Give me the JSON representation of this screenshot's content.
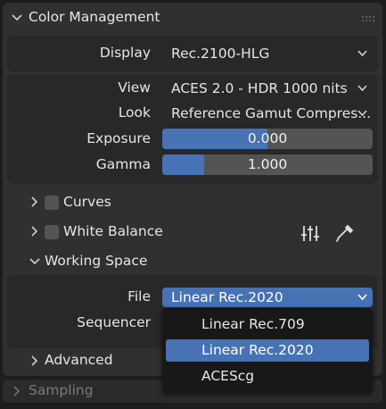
{
  "panel": {
    "title": "Color Management"
  },
  "display": {
    "label": "Display",
    "value": "Rec.2100-HLG"
  },
  "view": {
    "label": "View",
    "value": "ACES 2.0 - HDR 1000 nits"
  },
  "look": {
    "label": "Look",
    "value": "Reference Gamut Compres..."
  },
  "exposure": {
    "label": "Exposure",
    "value": "0.000",
    "fill_fraction": 0.5
  },
  "gamma": {
    "label": "Gamma",
    "value": "1.000",
    "fill_fraction": 0.2
  },
  "curves": {
    "label": "Curves",
    "checked": false
  },
  "white_balance": {
    "label": "White Balance",
    "checked": false,
    "icons": [
      "sliders-icon",
      "eyedropper-icon"
    ]
  },
  "working_space": {
    "title": "Working Space",
    "file": {
      "label": "File",
      "value": "Linear Rec.2020"
    },
    "sequencer": {
      "label": "Sequencer"
    }
  },
  "dropdown": {
    "options": [
      "Linear Rec.709",
      "Linear Rec.2020",
      "ACEScg"
    ],
    "selected": "Linear Rec.2020"
  },
  "advanced": {
    "title": "Advanced"
  },
  "sampling": {
    "title": "Sampling"
  },
  "colors": {
    "accent": "#4772b3",
    "panel": "#303030",
    "field": "#545454"
  }
}
